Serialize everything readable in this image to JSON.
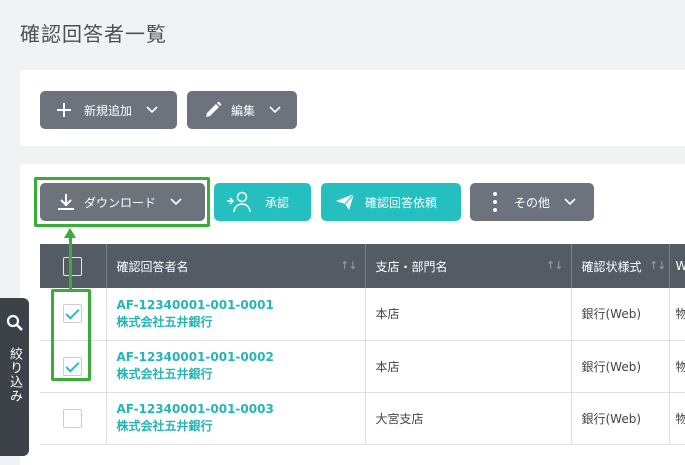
{
  "page": {
    "title": "確認回答者一覧"
  },
  "toolbar_top": {
    "add_label": "新規追加",
    "edit_label": "編集"
  },
  "toolbar_main": {
    "download_label": "ダウンロード",
    "approve_label": "承認",
    "request_label": "確認回答依頼",
    "other_label": "その他"
  },
  "table": {
    "columns": [
      "確認回答者名",
      "支店・部門名",
      "確認状様式",
      "W"
    ],
    "rows": [
      {
        "code": "AF-12340001-001-0001",
        "bank": "株式会社五井銀行",
        "branch": "本店",
        "format": "銀行(Web)",
        "extra": "物",
        "checked": true
      },
      {
        "code": "AF-12340001-001-0002",
        "bank": "株式会社五井銀行",
        "branch": "本店",
        "format": "銀行(Web)",
        "extra": "物",
        "checked": true
      },
      {
        "code": "AF-12340001-001-0003",
        "bank": "株式会社五井銀行",
        "branch": "大宮支店",
        "format": "銀行(Web)",
        "extra": "物",
        "checked": false
      }
    ]
  },
  "side_filter": {
    "label": "絞り込み"
  },
  "colors": {
    "teal": "#26bfc0",
    "gray_button": "#6d737d",
    "header": "#555b65",
    "highlight": "#3bab3a"
  }
}
